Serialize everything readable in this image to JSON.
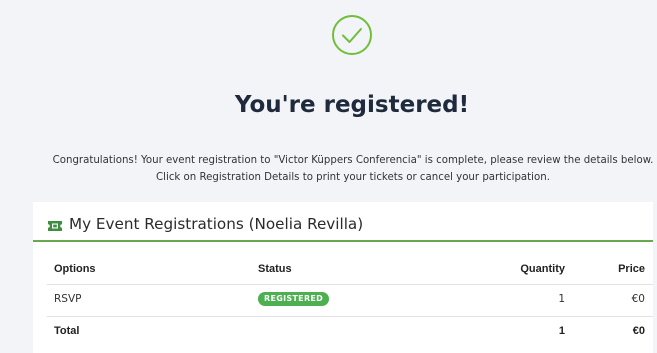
{
  "confirmation": {
    "icon": "check-circle-icon",
    "heading": "You're registered!",
    "message_line1": "Congratulations! Your event registration to \"Victor Küppers Conferencia\" is complete, please review the details below.",
    "message_line2": "Click on Registration Details to print your tickets or cancel your participation."
  },
  "registrations": {
    "icon": "ticket-icon",
    "title": "My Event Registrations (Noelia Revilla)",
    "columns": {
      "options": "Options",
      "status": "Status",
      "quantity": "Quantity",
      "price": "Price"
    },
    "rows": [
      {
        "option": "RSVP",
        "status": "REGISTERED",
        "quantity": "1",
        "price": "€0"
      }
    ],
    "total": {
      "label": "Total",
      "quantity": "1",
      "price": "€0"
    }
  },
  "colors": {
    "accent_green": "#6aa84f",
    "badge_green": "#4caf50",
    "heading": "#1f2a3d",
    "background": "#f3f4f7"
  }
}
